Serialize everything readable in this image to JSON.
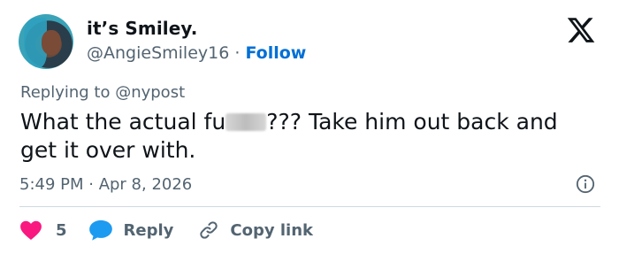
{
  "author": {
    "display_name": "it’s Smiley.",
    "handle": "@AngieSmiley16",
    "separator": " · ",
    "follow_label": "Follow"
  },
  "reply_context": "Replying to @nypost",
  "tweet": {
    "text_before": "What the actual fu",
    "text_after": "??? Take him out back and get it over with."
  },
  "meta": {
    "timestamp": "5:49 PM · Apr 8, 2026"
  },
  "actions": {
    "like_count": "5",
    "reply_label": "Reply",
    "copy_link_label": "Copy link"
  },
  "colors": {
    "like": "#f91880",
    "reply": "#1d9bf0",
    "follow": "#006fd6",
    "muted": "#536471"
  },
  "icons": {
    "brand": "x-logo-icon",
    "info": "info-icon",
    "like": "heart-icon",
    "reply": "speech-bubble-icon",
    "copy_link": "link-icon"
  }
}
